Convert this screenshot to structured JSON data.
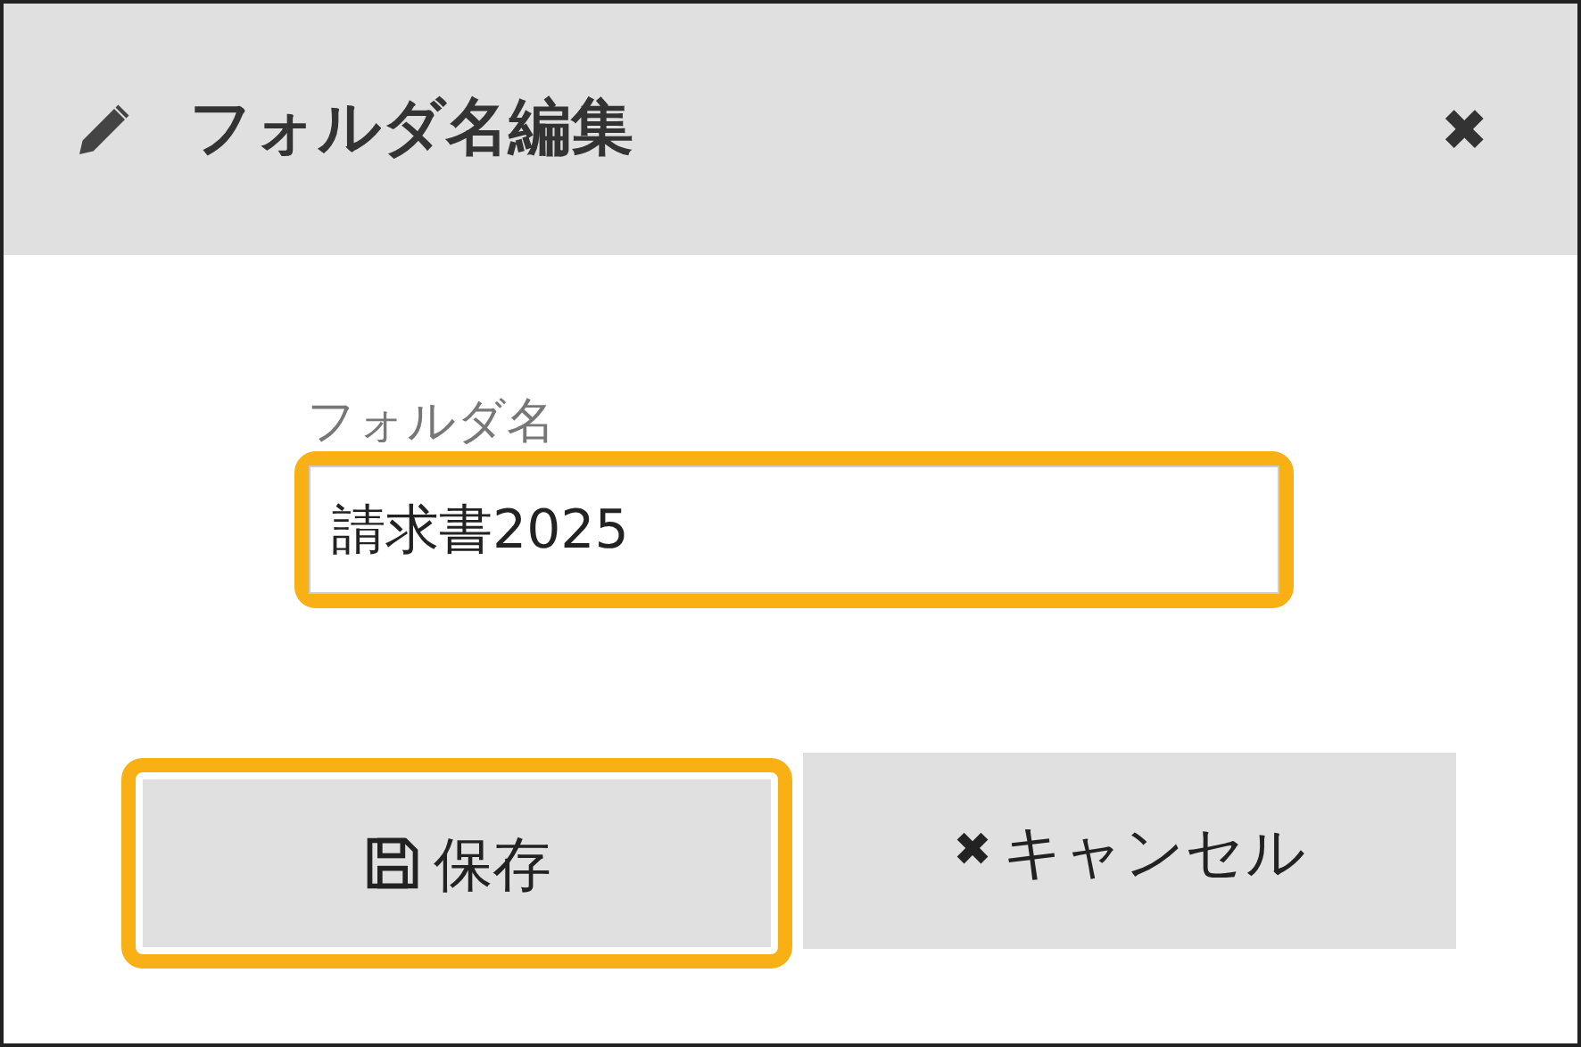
{
  "dialog": {
    "title": "フォルダ名編集",
    "close_icon": "✖"
  },
  "field": {
    "label": "フォルダ名",
    "value": "請求書2025",
    "highlighted": true
  },
  "buttons": [
    {
      "kind": "save",
      "label": "保存",
      "highlighted": true
    },
    {
      "kind": "cancel",
      "label": "キャンセル",
      "icon": "✖",
      "highlighted": false
    }
  ]
}
